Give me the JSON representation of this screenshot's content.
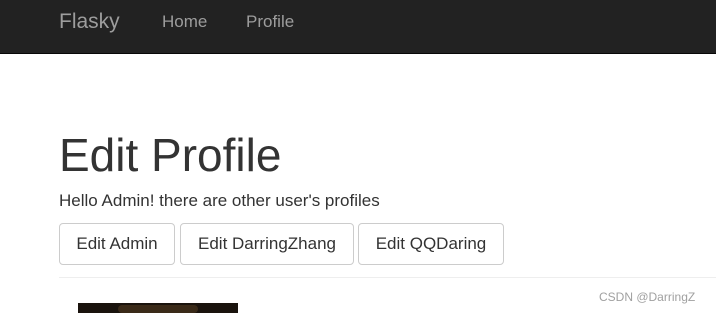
{
  "navbar": {
    "brand": "Flasky",
    "links": [
      "Home",
      "Profile"
    ],
    "background": "#222222",
    "link_color": "#9d9d9d"
  },
  "main": {
    "title": "Edit Profile",
    "greeting": "Hello Admin! there are other user's profiles",
    "buttons": [
      "Edit Admin",
      "Edit DarringZhang",
      "Edit QQDaring"
    ]
  },
  "watermark": "CSDN @DarringZ"
}
